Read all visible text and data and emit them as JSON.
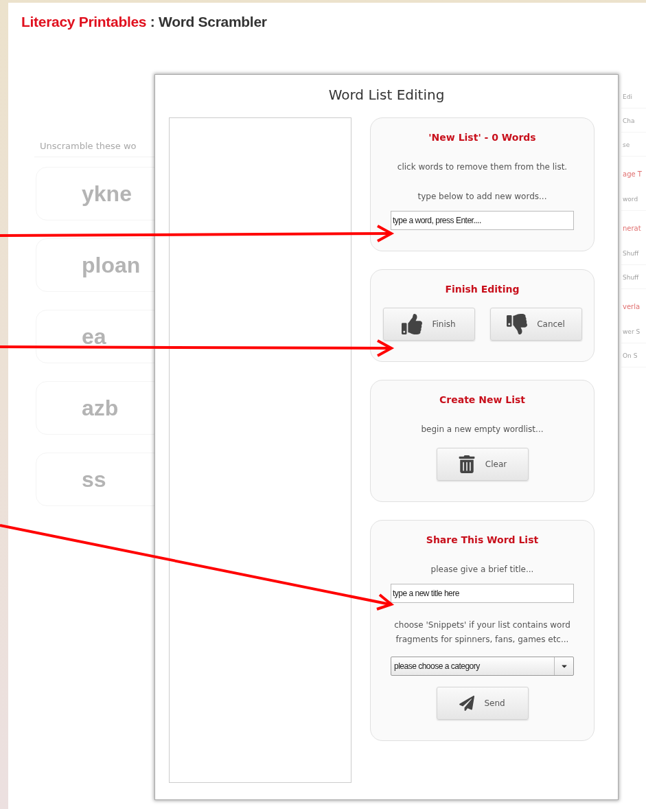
{
  "page_title": {
    "brand": "Literacy Printables",
    "separator": ":",
    "name": "Word Scrambler"
  },
  "background": {
    "left_header": "Unscramble these wo",
    "words": [
      "ykne",
      "ploan",
      "ea",
      "azb",
      "ss"
    ],
    "right_items": [
      {
        "kind": "label",
        "text": "Edi"
      },
      {
        "kind": "label",
        "text": "Cha"
      },
      {
        "kind": "label",
        "text": "se"
      },
      {
        "kind": "heading",
        "text": "age T"
      },
      {
        "kind": "label",
        "text": "word"
      },
      {
        "kind": "heading",
        "text": "nerat"
      },
      {
        "kind": "label",
        "text": "Shuff"
      },
      {
        "kind": "label",
        "text": "Shuff"
      },
      {
        "kind": "heading",
        "text": "verla"
      },
      {
        "kind": "label",
        "text": "wer S"
      },
      {
        "kind": "label",
        "text": "On S"
      }
    ]
  },
  "dialog": {
    "title": "Word List Editing",
    "panels": [
      {
        "heading": "'New List' - 0 Words",
        "items": [
          {
            "kind": "text",
            "text": "click words to remove them from the list."
          },
          {
            "kind": "text",
            "text": "type below to add new words..."
          },
          {
            "kind": "input",
            "placeholder": "type a word, press Enter...."
          }
        ]
      },
      {
        "heading": "Finish Editing",
        "items": [
          {
            "kind": "buttons",
            "buttons": [
              {
                "kind": "thumbs-up",
                "label": "Finish"
              },
              {
                "kind": "thumbs-down",
                "label": "Cancel"
              }
            ]
          }
        ]
      },
      {
        "heading": "Create New List",
        "items": [
          {
            "kind": "text",
            "text": "begin a new empty wordlist..."
          },
          {
            "kind": "buttons",
            "buttons": [
              {
                "kind": "trash",
                "label": "Clear"
              }
            ]
          }
        ]
      },
      {
        "heading": "Share This Word List",
        "items": [
          {
            "kind": "text",
            "text": "please give a brief title..."
          },
          {
            "kind": "input",
            "placeholder": "type a new title here"
          },
          {
            "kind": "text",
            "text": "choose 'Snippets' if your list contains word fragments for spinners, fans, games etc..."
          },
          {
            "kind": "select",
            "value": "please choose a category"
          },
          {
            "kind": "buttons",
            "buttons": [
              {
                "kind": "send",
                "label": "Send"
              }
            ]
          }
        ]
      }
    ]
  }
}
